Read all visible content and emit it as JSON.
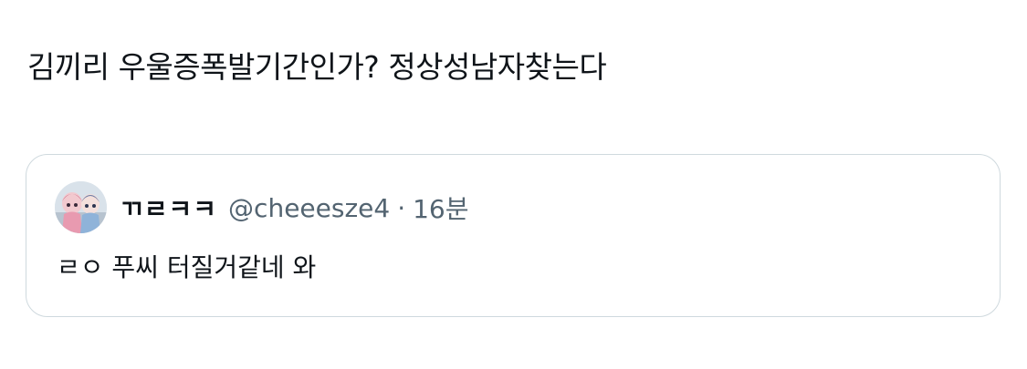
{
  "tweet": {
    "text": "김끼리 우울증폭발기간인가? 정상성남자찾는다"
  },
  "quote": {
    "display_name": "ㄲㄹㅋㅋ",
    "handle": "@cheeesze4",
    "separator": "·",
    "time": "16분",
    "text": "ㄹㅇ 푸씨 터질거같네 와",
    "avatar_icon": "profile-avatar-dolls"
  },
  "colors": {
    "text_primary": "#0f1419",
    "text_secondary": "#536471",
    "card_border": "#cfd9de",
    "background": "#ffffff"
  }
}
